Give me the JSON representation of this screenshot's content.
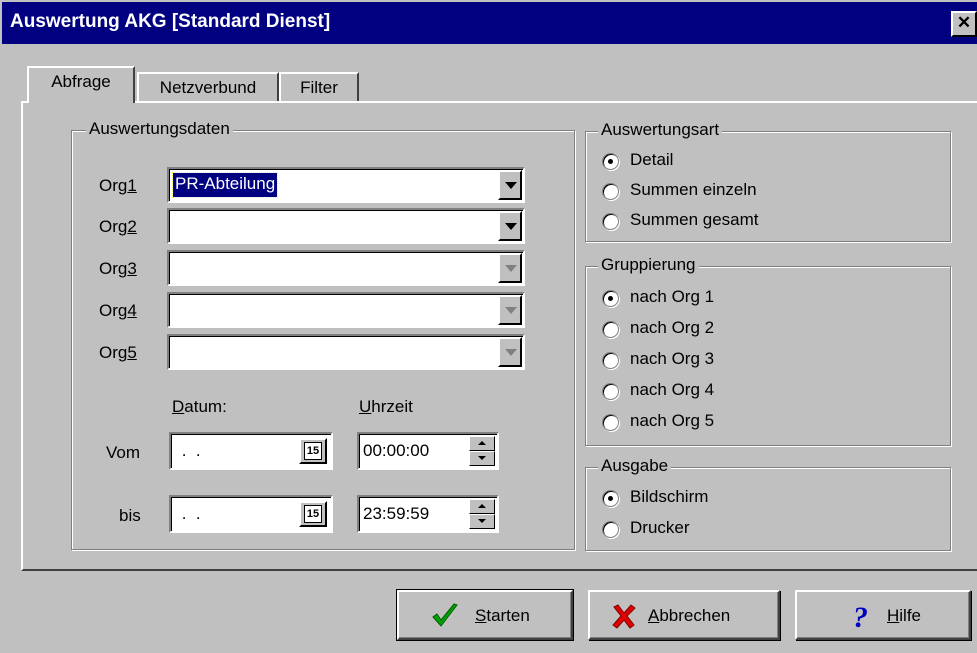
{
  "window": {
    "title": "Auswertung AKG [Standard Dienst]",
    "close_glyph": "✕"
  },
  "tabs": [
    {
      "label": "Abfrage",
      "active": true
    },
    {
      "label": "Netzverbund",
      "active": false
    },
    {
      "label": "Filter",
      "active": false
    }
  ],
  "auswertungsdaten": {
    "title": "Auswertungsdaten",
    "orgs": [
      {
        "label_prefix": "Org",
        "label_key": "1",
        "value": "PR-Abteilung",
        "enabled": true
      },
      {
        "label_prefix": "Org",
        "label_key": "2",
        "value": "",
        "enabled": true
      },
      {
        "label_prefix": "Org",
        "label_key": "3",
        "value": "",
        "enabled": false
      },
      {
        "label_prefix": "Org",
        "label_key": "4",
        "value": "",
        "enabled": false
      },
      {
        "label_prefix": "Org",
        "label_key": "5",
        "value": "",
        "enabled": false
      }
    ],
    "datum_label_key": "D",
    "datum_label_rest": "atum:",
    "uhrzeit_label_key": "U",
    "uhrzeit_label_rest": "hrzeit",
    "vom_label": "Vom",
    "bis_label": "bis",
    "vom_date": " .  .",
    "bis_date": " .  .",
    "vom_time": "00:00:00",
    "bis_time": "23:59:59",
    "calendar_icon_text": "15"
  },
  "auswertungsart": {
    "title": "Auswertungsart",
    "options": [
      "Detail",
      "Summen einzeln",
      "Summen gesamt"
    ],
    "selected": 0
  },
  "gruppierung": {
    "title": "Gruppierung",
    "options": [
      "nach Org 1",
      "nach Org 2",
      "nach Org 3",
      "nach Org 4",
      "nach Org 5"
    ],
    "selected": 0
  },
  "ausgabe": {
    "title": "Ausgabe",
    "options": [
      "Bildschirm",
      "Drucker"
    ],
    "selected": 0
  },
  "buttons": {
    "start_key": "S",
    "start_rest": "tarten",
    "cancel_key": "A",
    "cancel_rest": "bbrechen",
    "help_key": "H",
    "help_rest": "ilfe"
  },
  "colors": {
    "titlebar": "#000080",
    "face": "#c0c0c0",
    "check": "#00a000",
    "cross": "#e00000",
    "help": "#0000c0"
  }
}
